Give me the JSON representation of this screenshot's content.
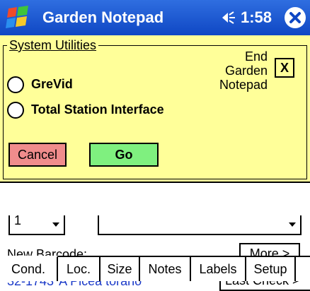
{
  "titlebar": {
    "app_title": "Garden Notepad",
    "time": "1:58"
  },
  "dialog": {
    "group_label": "System Utilities",
    "end_label": "End Garden Notepad",
    "close_label": "X",
    "options": [
      {
        "label": "GreVid"
      },
      {
        "label": "Total Station Interface"
      }
    ],
    "cancel_label": "Cancel",
    "go_label": "Go"
  },
  "form": {
    "left_select_value": "1",
    "new_barcode_label": "New Barcode:",
    "more_label": "More >",
    "plant_info": "32-1743*A Picea torano",
    "last_check_label": "Last Check >"
  },
  "tabs": [
    {
      "label": "Cond."
    },
    {
      "label": "Loc."
    },
    {
      "label": "Size"
    },
    {
      "label": "Notes"
    },
    {
      "label": "Labels"
    },
    {
      "label": "Setup"
    }
  ],
  "colors": {
    "titlebar": "#1f5ad6",
    "dialog_bg": "#ffff99",
    "cancel_bg": "#f08c8c",
    "go_bg": "#7ff07f",
    "plant_text": "#1a39c8"
  }
}
